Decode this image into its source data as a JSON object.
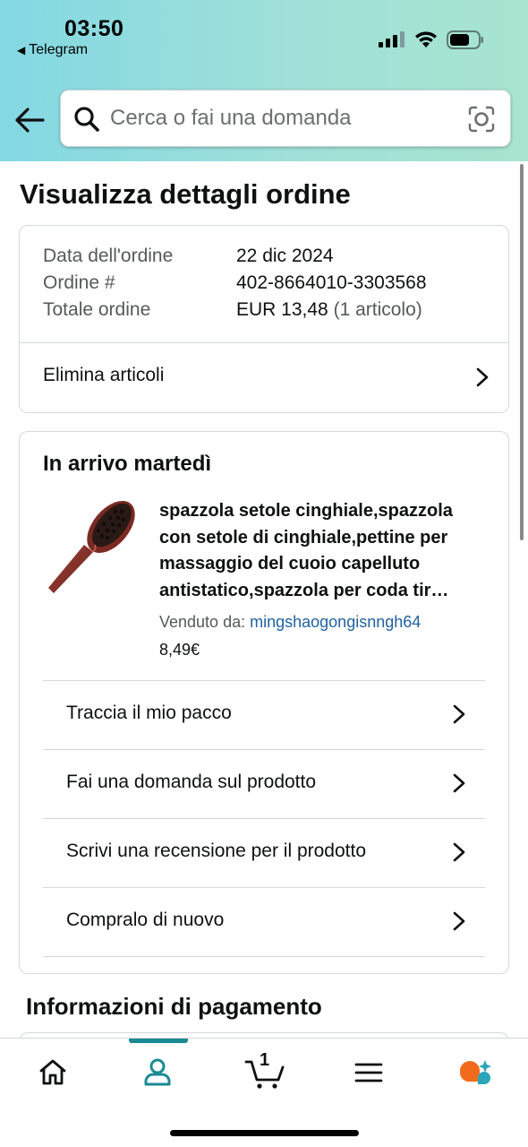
{
  "status_bar": {
    "time": "03:50",
    "back_app": "Telegram"
  },
  "search": {
    "placeholder": "Cerca o fai una domanda"
  },
  "page": {
    "title": "Visualizza dettagli ordine"
  },
  "order_summary": {
    "rows": [
      {
        "label": "Data dell'ordine",
        "value": "22 dic 2024"
      },
      {
        "label": "Ordine #",
        "value": "402-8664010-3303568"
      },
      {
        "label": "Totale ordine",
        "value": "EUR 13,48",
        "extra": "(1 articolo)"
      }
    ],
    "delete_items_label": "Elimina articoli"
  },
  "shipment": {
    "status": "In arrivo martedì",
    "product": {
      "title": "spazzola setole cinghiale,spazzola con setole di cinghiale,pettine per massaggio del cuoio capelluto antistatico,spazzola per coda tir…",
      "sold_by_label": "Venduto da:",
      "seller": "mingshaogongisnngh64",
      "price": "8,49€"
    },
    "actions": [
      "Traccia il mio pacco",
      "Fai una domanda sul prodotto",
      "Scrivi una recensione per il prodotto",
      "Compralo di nuovo"
    ]
  },
  "payment": {
    "heading": "Informazioni di pagamento"
  },
  "bottom_nav": {
    "items": [
      "home-icon",
      "account-icon",
      "cart-icon",
      "menu-icon",
      "rufus-icon"
    ],
    "active": "account-icon",
    "cart_count": "1"
  },
  "colors": {
    "header_gradient_start": "#83d8e3",
    "header_gradient_end": "#a8e4cf",
    "link": "#2162a1",
    "accent": "#1b8a94",
    "rufus_orange": "#f26b1d",
    "rufus_teal": "#2aa6b8"
  }
}
